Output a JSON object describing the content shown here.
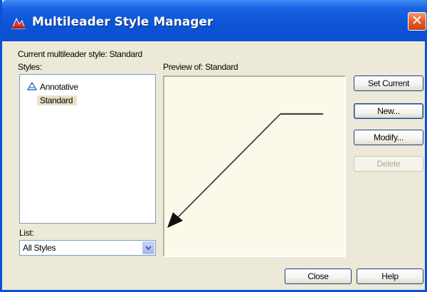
{
  "window": {
    "title": "Multileader Style Manager",
    "close_glyph": "✕"
  },
  "current_style": {
    "label": "Current multileader style: Standard"
  },
  "styles": {
    "label": "Styles:",
    "items": [
      {
        "name": "Annotative",
        "icon": "annotative-icon"
      },
      {
        "name": "Standard",
        "icon": "",
        "selected": true
      }
    ]
  },
  "preview": {
    "label": "Preview of: Standard"
  },
  "list": {
    "label": "List:",
    "selected": "All Styles"
  },
  "buttons": {
    "set_current": "Set Current",
    "new": "New...",
    "modify": "Modify...",
    "delete": "Delete",
    "close": "Close",
    "help": "Help"
  },
  "colors": {
    "titlebar": "#0a4fcf",
    "dialog_bg": "#ece9d8",
    "preview_bg": "#fbf9ea",
    "selection_bg": "#e8e3c8"
  }
}
